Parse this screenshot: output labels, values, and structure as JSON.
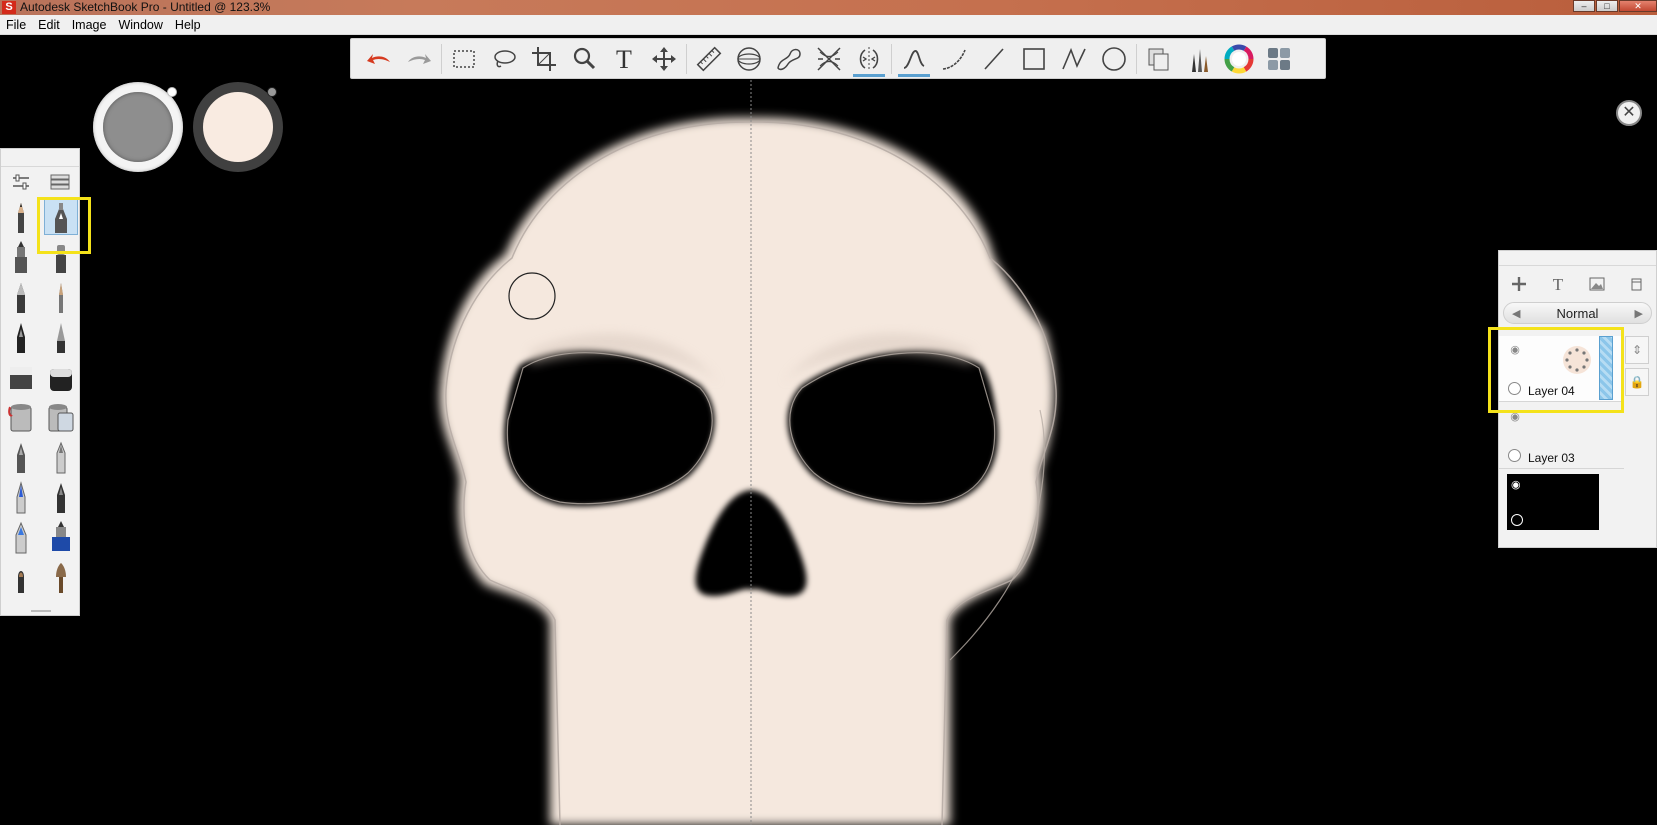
{
  "window": {
    "title": "Autodesk SketchBook Pro - Untitled @ 123.3%",
    "app_icon": "S",
    "controls": [
      "minimize",
      "maximize",
      "close"
    ]
  },
  "menu": [
    "File",
    "Edit",
    "Image",
    "Window",
    "Help"
  ],
  "toolbar": {
    "items": [
      {
        "name": "undo",
        "icon": "undo-arrow-icon"
      },
      {
        "name": "redo",
        "icon": "redo-arrow-icon"
      },
      {
        "name": "rectangle-select",
        "icon": "rect-select-icon"
      },
      {
        "name": "lasso",
        "icon": "lasso-icon"
      },
      {
        "name": "crop",
        "icon": "crop-icon"
      },
      {
        "name": "zoom",
        "icon": "magnifier-icon"
      },
      {
        "name": "text",
        "icon": "text-icon",
        "label": "T"
      },
      {
        "name": "transform",
        "icon": "move-icon"
      },
      {
        "name": "ruler",
        "icon": "ruler-icon"
      },
      {
        "name": "ellipse-guide",
        "icon": "ellipse-guide-icon"
      },
      {
        "name": "french-curve",
        "icon": "french-curve-icon"
      },
      {
        "name": "perspective",
        "icon": "perspective-icon"
      },
      {
        "name": "symmetry",
        "icon": "symmetry-icon",
        "active": true
      },
      {
        "name": "predictive-stroke",
        "icon": "stroke-icon",
        "active": true
      },
      {
        "name": "curve",
        "icon": "curve-icon"
      },
      {
        "name": "line",
        "icon": "line-icon"
      },
      {
        "name": "rectangle",
        "icon": "rectangle-icon"
      },
      {
        "name": "polyline",
        "icon": "polyline-icon"
      },
      {
        "name": "ellipse",
        "icon": "ellipse-icon"
      },
      {
        "name": "copy-paste",
        "icon": "copy-icon"
      },
      {
        "name": "brushes",
        "icon": "brushes-icon"
      },
      {
        "name": "color-wheel",
        "icon": "color-wheel-icon"
      },
      {
        "name": "layers",
        "icon": "layers-icon"
      }
    ]
  },
  "color_pucks": {
    "gray": "#8e8e8e",
    "active_color": "#f9ebe1"
  },
  "brush_palette": {
    "tool_icons": [
      "brush-settings-icon",
      "brush-library-icon"
    ],
    "brushes": [
      "pencil-brush-icon",
      "technical-pen-brush-icon",
      "marker-brush-icon",
      "chisel-marker-brush-icon",
      "ballpoint-brush-icon",
      "fine-brush-icon",
      "ink-pen-brush-icon",
      "fountain-pen-brush-icon",
      "eraser-brush-icon",
      "hard-eraser-brush-icon",
      "paint-bucket-brush-icon",
      "fill-bucket-brush-icon",
      "felt-tip-brush-icon",
      "round-tip-brush-icon",
      "blue-pen-brush-icon",
      "airbrush-brush-icon",
      "blue-marker-brush-icon",
      "blue-ink-brush-icon",
      "round-brush-icon",
      "paint-brush-icon"
    ],
    "selected_index": 1
  },
  "layers": {
    "blend_mode": "Normal",
    "tool_icons": [
      "add-layer-icon",
      "add-text-layer-icon",
      "add-image-layer-icon",
      "layer-menu-icon"
    ],
    "items": [
      {
        "name": "Layer 04",
        "active": true
      },
      {
        "name": "Layer 03",
        "active": false
      },
      {
        "name": "",
        "background": "#000000"
      }
    ]
  },
  "canvas": {
    "background": "#000000",
    "skull_color": "#f5e8de",
    "symmetry_line": true
  }
}
